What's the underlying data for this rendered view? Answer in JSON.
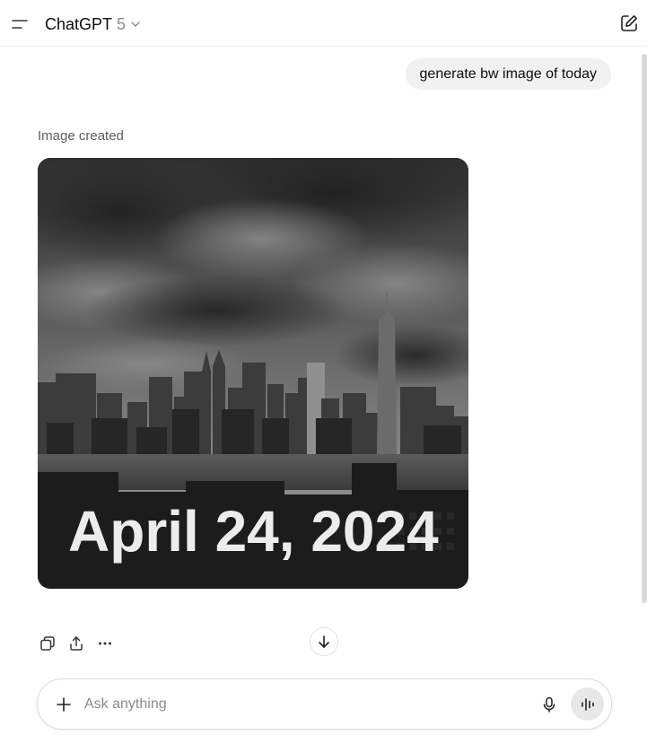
{
  "header": {
    "model_name": "ChatGPT",
    "model_version": "5"
  },
  "conversation": {
    "user_message": "generate bw image of today",
    "assistant": {
      "status": "Image created",
      "image_caption_text": "April 24, 2024"
    }
  },
  "composer": {
    "placeholder": "Ask anything",
    "value": ""
  },
  "icons": {
    "menu": "menu-icon",
    "model_chevron": "chevron-down-icon",
    "new_chat": "edit-icon",
    "copy": "copy-icon",
    "share": "share-icon",
    "more": "more-icon",
    "scroll_down": "arrow-down-icon",
    "plus": "plus-icon",
    "mic": "mic-icon",
    "voice": "voice-mode-icon"
  },
  "colors": {
    "user_bubble": "#f1f1f1",
    "voice_button": "#e8e8e8"
  }
}
